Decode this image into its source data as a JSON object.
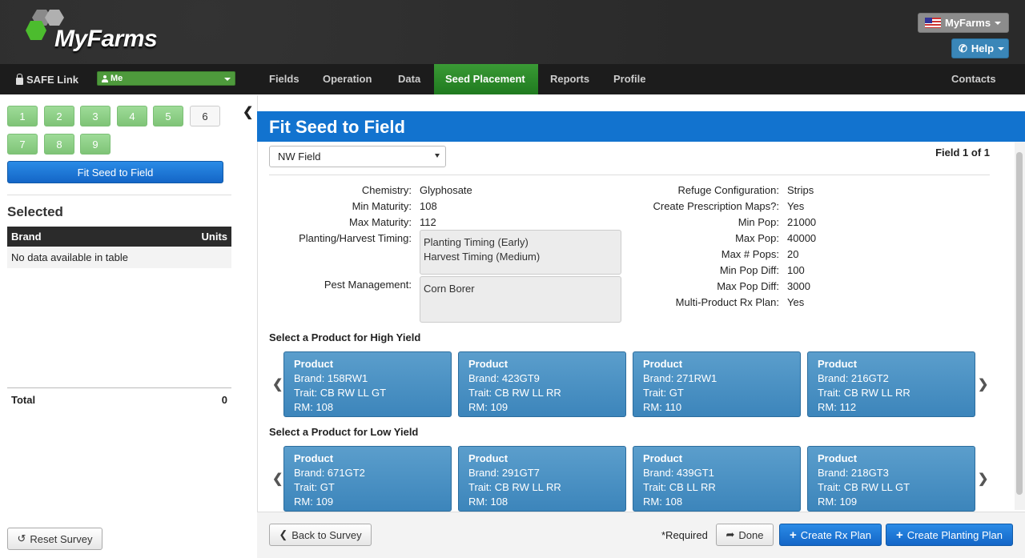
{
  "header": {
    "logo_text": "MyFarms",
    "myfarms_btn": "MyFarms",
    "help_btn": "Help"
  },
  "navbar": {
    "safe_link": "SAFE Link",
    "me_select": "Me",
    "items": [
      "Fields",
      "Operation",
      "Data",
      "Seed Placement",
      "Reports",
      "Profile"
    ],
    "active": "Seed Placement",
    "contacts": "Contacts"
  },
  "sidebar": {
    "steps": [
      "1",
      "2",
      "3",
      "4",
      "5",
      "6",
      "7",
      "8",
      "9"
    ],
    "fit_button": "Fit Seed to Field",
    "selected_title": "Selected",
    "table_headers": [
      "Brand",
      "Units"
    ],
    "empty_text": "No data available in table",
    "total_label": "Total",
    "total_value": "0",
    "reset_button": "Reset Survey"
  },
  "main": {
    "title": "Fit Seed to Field",
    "field_select": "NW Field",
    "field_count": "Field 1 of 1",
    "left_props": [
      {
        "label": "Chemistry:",
        "value": "Glyphosate"
      },
      {
        "label": "Min Maturity:",
        "value": "108"
      },
      {
        "label": "Max Maturity:",
        "value": "112"
      }
    ],
    "timing_label": "Planting/Harvest Timing:",
    "timing_values": [
      "Planting Timing (Early)",
      "Harvest Timing (Medium)"
    ],
    "pest_label": "Pest Management:",
    "pest_values": [
      "Corn Borer"
    ],
    "right_props": [
      {
        "label": "Refuge Configuration:",
        "value": "Strips"
      },
      {
        "label": "Create Prescription Maps?:",
        "value": "Yes"
      },
      {
        "label": "Min Pop:",
        "value": "21000"
      },
      {
        "label": "Max Pop:",
        "value": "40000"
      },
      {
        "label": "Max # Pops:",
        "value": "20"
      },
      {
        "label": "Min Pop Diff:",
        "value": "100"
      },
      {
        "label": "Max Pop Diff:",
        "value": "3000"
      },
      {
        "label": "Multi-Product Rx Plan:",
        "value": "Yes"
      }
    ],
    "high_yield_title": "Select a Product for High Yield",
    "high_yield": [
      {
        "name": "Product",
        "brand": "Brand: 158RW1",
        "trait": "Trait: CB RW LL GT",
        "rm": "RM: 108"
      },
      {
        "name": "Product",
        "brand": "Brand: 423GT9",
        "trait": "Trait: CB RW LL RR",
        "rm": "RM: 109"
      },
      {
        "name": "Product",
        "brand": "Brand: 271RW1",
        "trait": "Trait: GT",
        "rm": "RM: 110"
      },
      {
        "name": "Product",
        "brand": "Brand: 216GT2",
        "trait": "Trait: CB RW LL RR",
        "rm": "RM: 112"
      }
    ],
    "low_yield_title": "Select a Product for Low Yield",
    "low_yield": [
      {
        "name": "Product",
        "brand": "Brand: 671GT2",
        "trait": "Trait: GT",
        "rm": "RM: 109"
      },
      {
        "name": "Product",
        "brand": "Brand: 291GT7",
        "trait": "Trait: CB RW LL RR",
        "rm": "RM: 108"
      },
      {
        "name": "Product",
        "brand": "Brand: 439GT1",
        "trait": "Trait: CB LL RR",
        "rm": "RM: 108"
      },
      {
        "name": "Product",
        "brand": "Brand: 218GT3",
        "trait": "Trait: CB RW LL GT",
        "rm": "RM: 109"
      }
    ]
  },
  "footer": {
    "back_button": "Back to Survey",
    "required": "*Required",
    "done_button": "Done",
    "rx_button": "Create Rx Plan",
    "planting_button": "Create Planting Plan"
  },
  "colors": {
    "brand_green": "#2e8b2e",
    "primary_blue": "#1273cf",
    "card_blue": "#4b91c4"
  }
}
